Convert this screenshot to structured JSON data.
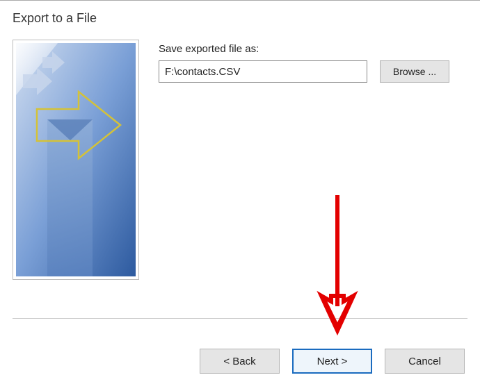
{
  "dialog": {
    "title": "Export to a File"
  },
  "form": {
    "label": "Save exported file as:",
    "filepath_value": "F:\\contacts.CSV",
    "browse_label": "Browse ..."
  },
  "buttons": {
    "back_label": "< Back",
    "next_label": "Next >",
    "cancel_label": "Cancel"
  }
}
